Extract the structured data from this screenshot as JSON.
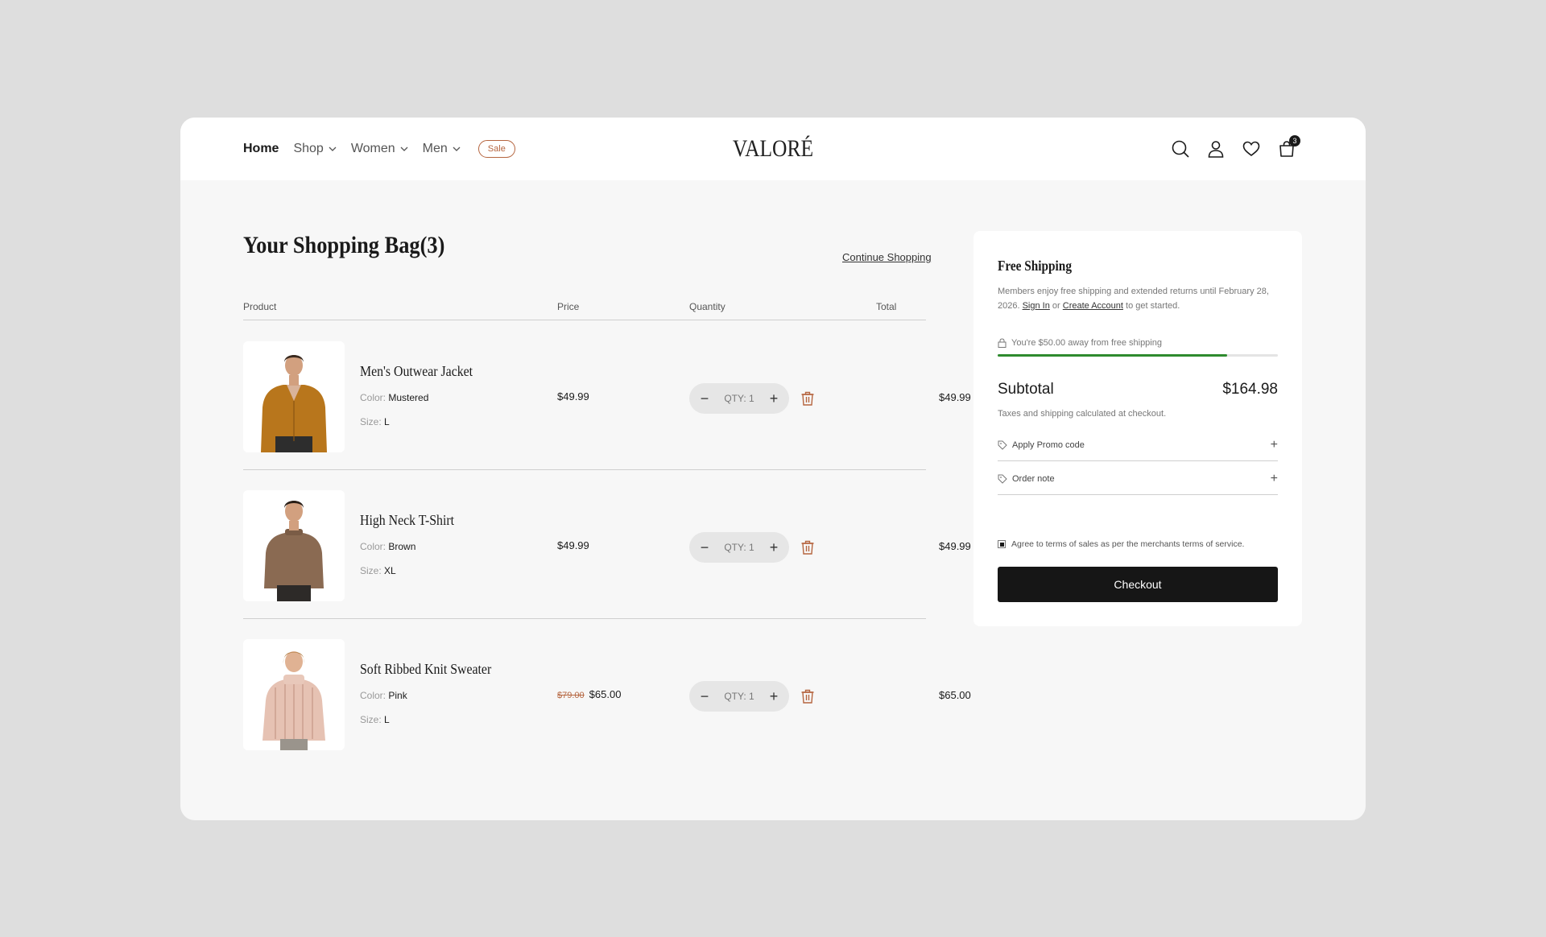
{
  "nav": {
    "items": [
      {
        "label": "Home",
        "active": true,
        "dropdown": false
      },
      {
        "label": "Shop",
        "active": false,
        "dropdown": true
      },
      {
        "label": "Women",
        "active": false,
        "dropdown": true
      },
      {
        "label": "Men",
        "active": false,
        "dropdown": true
      }
    ],
    "sale_label": "Sale"
  },
  "brand": {
    "logo": "VALORÉ"
  },
  "header_icons": [
    "search-icon",
    "user-icon",
    "heart-icon",
    "bag-icon"
  ],
  "cart_count": "3",
  "bag": {
    "title": "Your Shopping Bag(3)",
    "continue_label": "Continue Shopping",
    "columns": {
      "product": "Product",
      "price": "Price",
      "quantity": "Quantity",
      "total": "Total"
    },
    "items": [
      {
        "name": "Men's Outwear Jacket",
        "color_label": "Color:",
        "color": "Mustered",
        "size_label": "Size:",
        "size": "L",
        "price": "$49.99",
        "old_price": "",
        "qty": "QTY: 1",
        "total": "$49.99"
      },
      {
        "name": "High Neck T-Shirt",
        "color_label": "Color:",
        "color": "Brown",
        "size_label": "Size:",
        "size": "XL",
        "price": "$49.99",
        "old_price": "",
        "qty": "QTY: 1",
        "total": "$49.99"
      },
      {
        "name": "Soft Ribbed Knit Sweater",
        "color_label": "Color:",
        "color": "Pink",
        "size_label": "Size:",
        "size": "L",
        "price": "$65.00",
        "old_price": "$79.00",
        "qty": "QTY: 1",
        "total": "$65.00"
      }
    ]
  },
  "summary": {
    "title": "Free Shipping",
    "desc_pre": "Members enjoy free shipping and extended returns until February 28, 2026.",
    "sign_in": "Sign In",
    "or": "or",
    "create_account": "Create Account",
    "desc_post": "to get started.",
    "shipping_msg": "You're $50.00 away from free shipping",
    "shipping_progress": 0.82,
    "subtotal_label": "Subtotal",
    "subtotal_value": "$164.98",
    "tax_note": "Taxes and shipping calculated at checkout.",
    "promo_label": "Apply Promo code",
    "note_label": "Order note",
    "agree_label": "Agree to terms of sales as per the merchants terms of service.",
    "checkout_label": "Checkout"
  },
  "colors": {
    "accent": "#b5653f",
    "progress": "#2e8b2e",
    "button": "#161616"
  }
}
